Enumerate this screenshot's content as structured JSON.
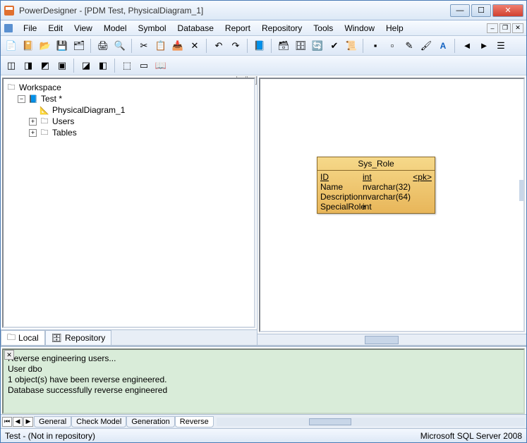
{
  "title": "PowerDesigner - [PDM Test, PhysicalDiagram_1]",
  "menus": [
    "File",
    "Edit",
    "View",
    "Model",
    "Symbol",
    "Database",
    "Report",
    "Repository",
    "Tools",
    "Window",
    "Help"
  ],
  "tree": {
    "root": "Workspace",
    "model": "Test *",
    "diagram": "PhysicalDiagram_1",
    "folders": [
      "Users",
      "Tables"
    ]
  },
  "left_tabs": {
    "local": "Local",
    "repo": "Repository"
  },
  "entity": {
    "name": "Sys_Role",
    "columns": [
      {
        "name": "ID",
        "type": "int",
        "key": "<pk>",
        "pk": true
      },
      {
        "name": "Name",
        "type": "nvarchar(32)",
        "key": "",
        "pk": false
      },
      {
        "name": "Description",
        "type": "nvarchar(64)",
        "key": "",
        "pk": false
      },
      {
        "name": "SpecialRole",
        "type": "int",
        "key": "",
        "pk": false
      }
    ]
  },
  "output": {
    "lines": [
      "Reverse engineering users...",
      "  User dbo",
      "  1 object(s) have been reverse engineered.",
      "",
      "Database successfully reverse engineered"
    ],
    "tabs": [
      "General",
      "Check Model",
      "Generation",
      "Reverse"
    ]
  },
  "status": {
    "left": "Test - (Not in repository)",
    "right": "Microsoft SQL Server 2008"
  }
}
